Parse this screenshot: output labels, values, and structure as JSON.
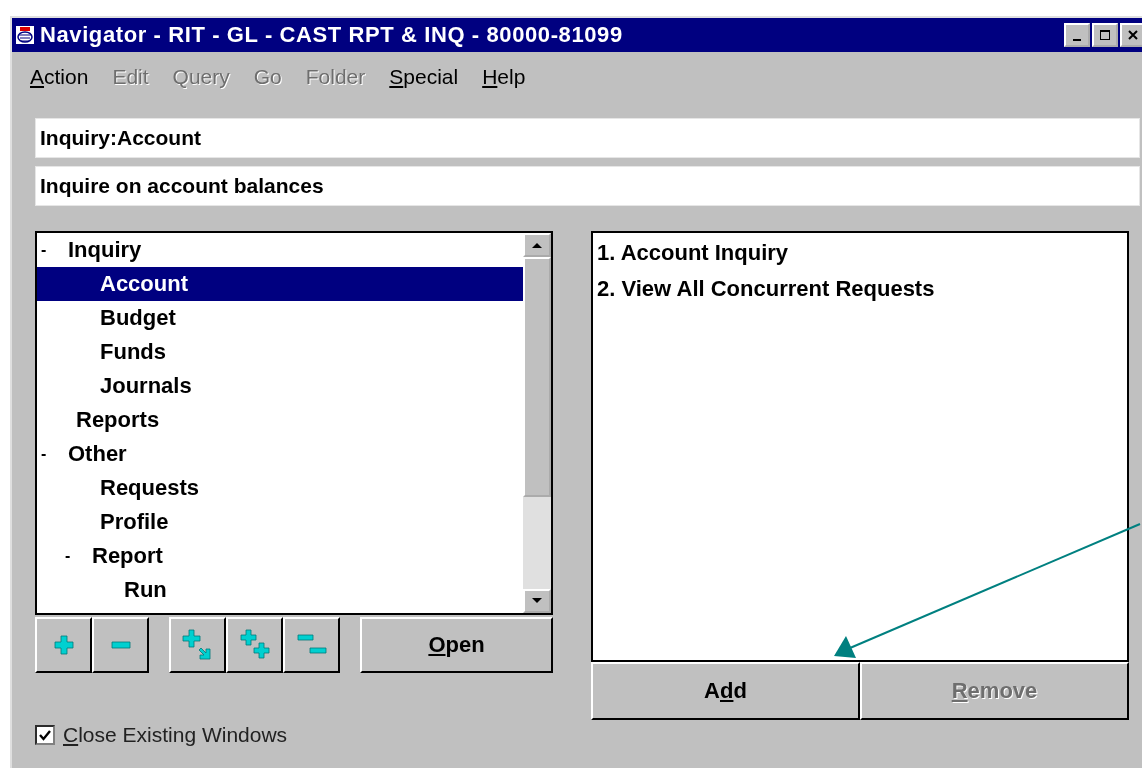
{
  "window": {
    "title": "Navigator - RIT - GL - CAST RPT & INQ - 80000-81099"
  },
  "menu": [
    {
      "key": "A",
      "after": "ction",
      "disabled": false
    },
    {
      "before": "Edit",
      "disabled": true
    },
    {
      "before": "Query",
      "disabled": true
    },
    {
      "before": "Go",
      "disabled": true
    },
    {
      "before": "Folder",
      "disabled": true
    },
    {
      "key": "S",
      "after": "pecial",
      "disabled": false
    },
    {
      "key": "H",
      "after": "elp",
      "disabled": false
    }
  ],
  "function_name": {
    "value": "Inquiry:Account"
  },
  "function_description": {
    "value": "Inquire on account balances"
  },
  "tree": [
    {
      "label": "Inquiry",
      "marker": "-",
      "selected": false,
      "children": [
        {
          "label": "Account",
          "selected": true
        },
        {
          "label": "Budget",
          "selected": false
        },
        {
          "label": "Funds",
          "selected": false
        },
        {
          "label": "Journals",
          "selected": false
        }
      ]
    },
    {
      "label": "Reports",
      "selected": false
    },
    {
      "label": "Other",
      "marker": "-",
      "selected": false,
      "children": [
        {
          "label": "Requests",
          "selected": false
        },
        {
          "label": "Profile",
          "selected": false
        },
        {
          "label": "Report",
          "marker": "-",
          "selected": false,
          "children": [
            {
              "label": "Run",
              "selected": false
            }
          ]
        }
      ]
    }
  ],
  "tree_buttons": [
    {
      "kind": "expand"
    },
    {
      "kind": "collapse"
    },
    {
      "kind": "expand-branch"
    },
    {
      "kind": "expand-all"
    },
    {
      "kind": "collapse-all"
    }
  ],
  "open_button": {
    "key": "O",
    "after": "pen"
  },
  "top_ten": [
    {
      "label": "1. Account Inquiry"
    },
    {
      "label": "2. View All Concurrent Requests"
    }
  ],
  "list_buttons": [
    {
      "before": "A",
      "key": "d",
      "after": "d",
      "disabled": false
    },
    {
      "key": "R",
      "after": "emove",
      "disabled": true
    }
  ],
  "close_windows": {
    "key": "C",
    "after": "lose Existing Windows",
    "checked": true
  }
}
